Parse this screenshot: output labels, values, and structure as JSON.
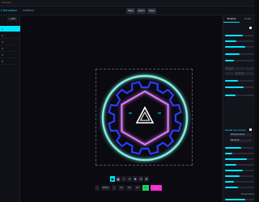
{
  "window": {
    "title": "Preview"
  },
  "topbar": {
    "brand": "t Generator",
    "project": "Untitled",
    "buttons": [
      "New",
      "Open",
      "Save"
    ]
  },
  "sidebar": {
    "add_label": "+ Add",
    "items": [
      "1",
      "2",
      "3",
      "4",
      "5",
      "6"
    ],
    "active_index": 0
  },
  "toolbar": {
    "icons": [
      "select-icon",
      "grid-icon",
      "minus-icon",
      "plus-icon",
      "move-icon",
      "fit-icon",
      "settings-icon"
    ]
  },
  "bottombar": {
    "zoom": "100%",
    "buttons": [
      "1x",
      "2x",
      "4x",
      "8x"
    ]
  },
  "panel": {
    "tabs": [
      "Shapes",
      "Code"
    ],
    "active_tab": 0,
    "section_title": "Radial Symmetry",
    "style_select": "Shadow Style",
    "mode_select": "Rainbow",
    "preset_label": "Preset Name"
  },
  "colors": {
    "accent": "#00e5ff",
    "blue": "#2a3bff",
    "magenta": "#e07bff",
    "green": "#1fd065",
    "pink": "#ff2bd6"
  }
}
